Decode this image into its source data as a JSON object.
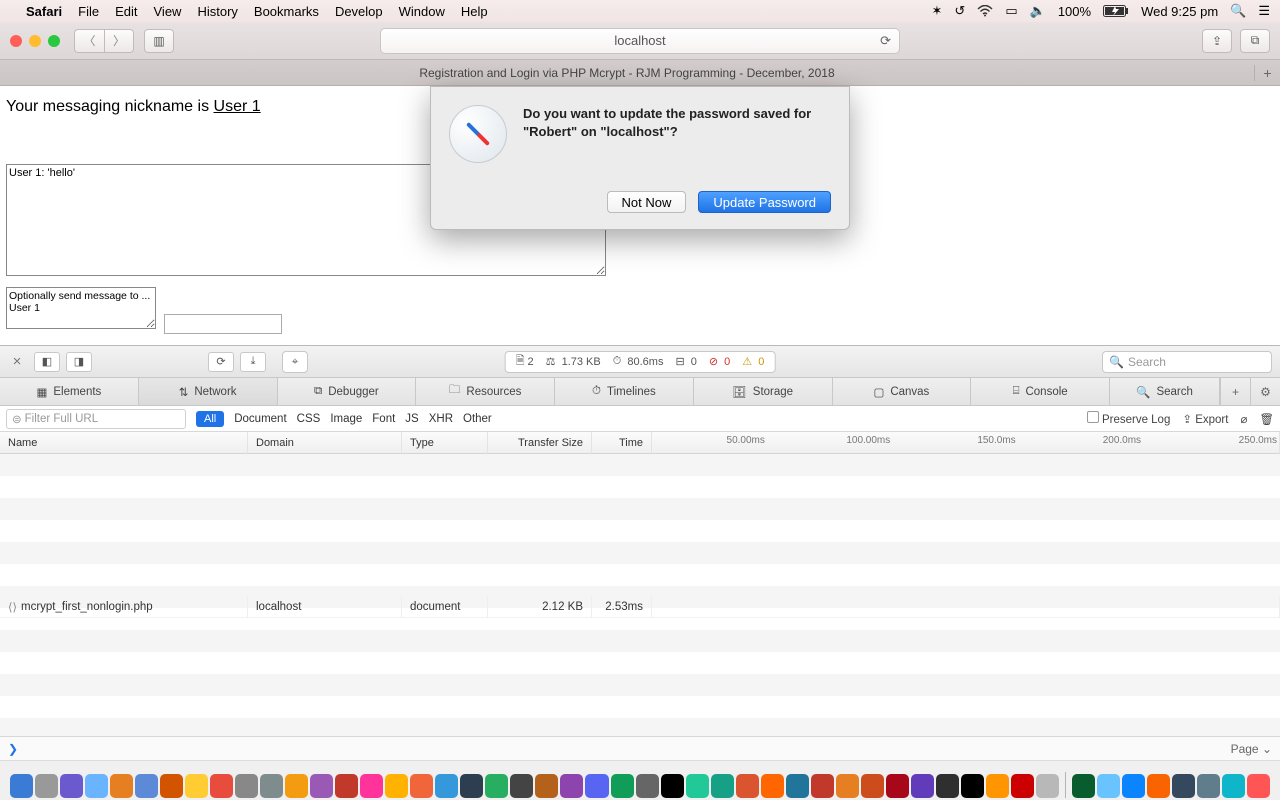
{
  "menubar": {
    "app": "Safari",
    "items": [
      "File",
      "Edit",
      "View",
      "History",
      "Bookmarks",
      "Develop",
      "Window",
      "Help"
    ],
    "battery": "100%",
    "clock": "Wed 9:25 pm"
  },
  "safari": {
    "url": "localhost",
    "tab_title": "Registration and Login via PHP Mcrypt - RJM Programming - December, 2018"
  },
  "page": {
    "nick_prefix": "Your messaging nickname is ",
    "nick_name": "User 1",
    "messages_value": "User 1: 'hello'",
    "opt_value": "Optionally send message to ...\nUser 1",
    "small_input": ""
  },
  "dialog": {
    "text": "Do you want to update the password saved for \"Robert\" on \"localhost\"?",
    "not_now": "Not Now",
    "update": "Update Password"
  },
  "devtools": {
    "stats": {
      "files": "2",
      "size": "1.73 KB",
      "time": "80.6ms",
      "log": "0",
      "err": "0",
      "warn": "0"
    },
    "search_placeholder": "Search",
    "tabs": [
      "Elements",
      "Network",
      "Debugger",
      "Resources",
      "Timelines",
      "Storage",
      "Canvas",
      "Console",
      "Search"
    ],
    "filter_placeholder": "Filter Full URL",
    "filters": {
      "all": "All",
      "list": [
        "Document",
        "CSS",
        "Image",
        "Font",
        "JS",
        "XHR",
        "Other"
      ]
    },
    "preserve": "Preserve Log",
    "export": "Export",
    "columns": [
      "Name",
      "Domain",
      "Type",
      "Transfer Size",
      "Time"
    ],
    "timeline_ticks": [
      "50.00ms",
      "100.00ms",
      "150.0ms",
      "200.0ms",
      "250.0ms"
    ],
    "row": {
      "name": "mcrypt_first_nonlogin.php",
      "domain": "localhost",
      "type": "document",
      "size": "2.12 KB",
      "time": "2.53ms"
    },
    "status_prompt": "❯",
    "status_right": "Page ⌄"
  },
  "dock_colors": [
    "#3a7bd5",
    "#999",
    "#6a5acd",
    "#6ab4ff",
    "#e67e22",
    "#5c8ad6",
    "#d35400",
    "#ffcc33",
    "#e74c3c",
    "#888",
    "#7f8c8d",
    "#f39c12",
    "#9b59b6",
    "#c0392b",
    "#ff3399",
    "#ffb300",
    "#f0653a",
    "#3498db",
    "#2c3e50",
    "#27ae60",
    "#444",
    "#b3611b",
    "#8e44ad",
    "#5865F2",
    "#0f9d58",
    "#666",
    "#000",
    "#20c997",
    "#16a085",
    "#DA552F",
    "#ff6600",
    "#21759b",
    "#c0392b",
    "#e67e22",
    "#cd4c1d",
    "#a8071a",
    "#603cba",
    "#2f2f2f",
    "#000",
    "#FF9500",
    "#cc0000",
    "#b8b8b8",
    "#095c2e",
    "#68c3ff",
    "#0a84ff",
    "#fa6400",
    "#34495e",
    "#607d8b",
    "#0fb5c8",
    "#ff5555"
  ]
}
